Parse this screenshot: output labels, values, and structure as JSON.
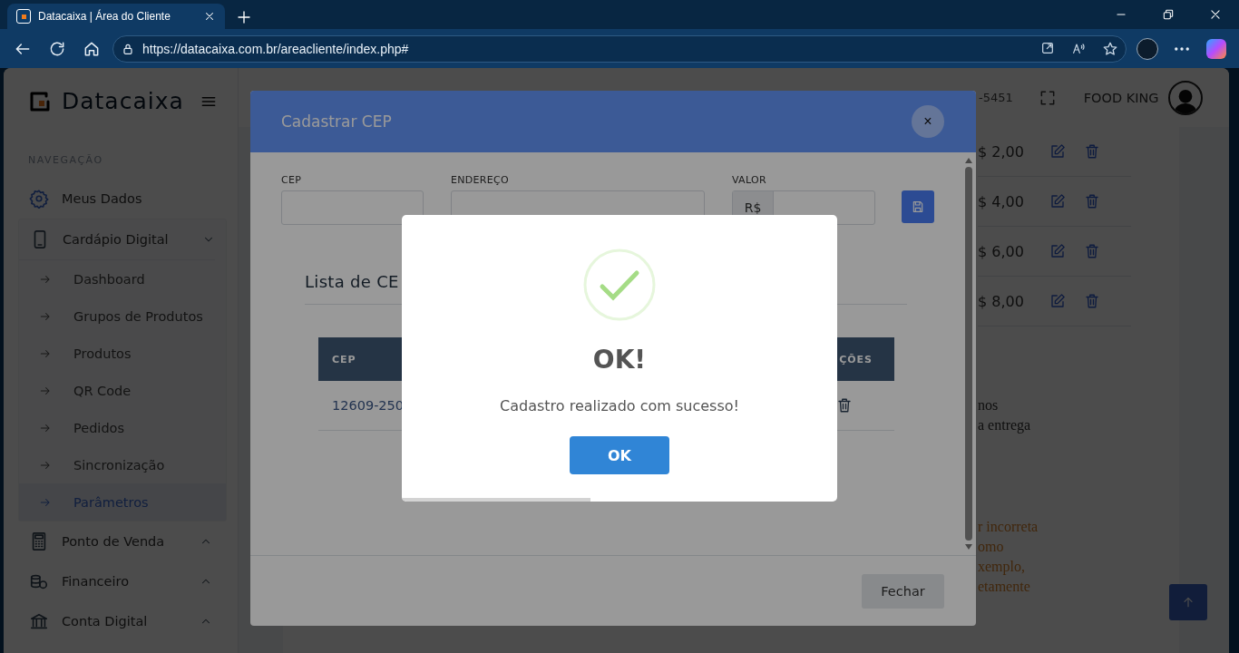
{
  "browser": {
    "tab_title": "Datacaixa | Área do Cliente",
    "url": "https://datacaixa.com.br/areacliente/index.php#"
  },
  "sidebar": {
    "brand": "Datacaixa",
    "section_label": "NAVEGAÇÃO",
    "items": [
      {
        "label": "Meus Dados"
      },
      {
        "label": "Cardápio Digital",
        "expanded": true,
        "children": [
          {
            "label": "Dashboard",
            "selected": false
          },
          {
            "label": "Grupos de Produtos",
            "selected": false
          },
          {
            "label": "Produtos",
            "selected": false
          },
          {
            "label": "QR Code",
            "selected": false
          },
          {
            "label": "Pedidos",
            "selected": false
          },
          {
            "label": "Sincronização",
            "selected": false
          },
          {
            "label": "Parâmetros",
            "selected": true
          }
        ]
      },
      {
        "label": "Ponto de Venda",
        "expanded": false
      },
      {
        "label": "Financeiro",
        "expanded": false
      },
      {
        "label": "Conta Digital",
        "expanded": false
      }
    ]
  },
  "header": {
    "phone": "-5451",
    "user": "FOOD KING"
  },
  "background": {
    "prices": [
      "$ 2,00",
      "$ 4,00",
      "$ 6,00",
      "$ 8,00"
    ],
    "notes": [
      "nos",
      "a entrega"
    ],
    "warnings": [
      "r incorreta",
      "omo",
      "xemplo,",
      "etamente"
    ]
  },
  "modal": {
    "title": "Cadastrar CEP",
    "close": "×",
    "fields": [
      {
        "label": "CEP"
      },
      {
        "label": "ENDEREÇO"
      },
      {
        "label": "VALOR",
        "prefix": "R$"
      }
    ],
    "list_title": "Lista de CE",
    "columns": [
      "CEP",
      "ÇÕES"
    ],
    "rows": [
      [
        "12609-250"
      ]
    ],
    "footer_button": "Fechar"
  },
  "alert": {
    "title": "OK!",
    "message": "Cadastro realizado com sucesso!",
    "button": "OK",
    "timer": {
      "level": 0.434
    }
  }
}
